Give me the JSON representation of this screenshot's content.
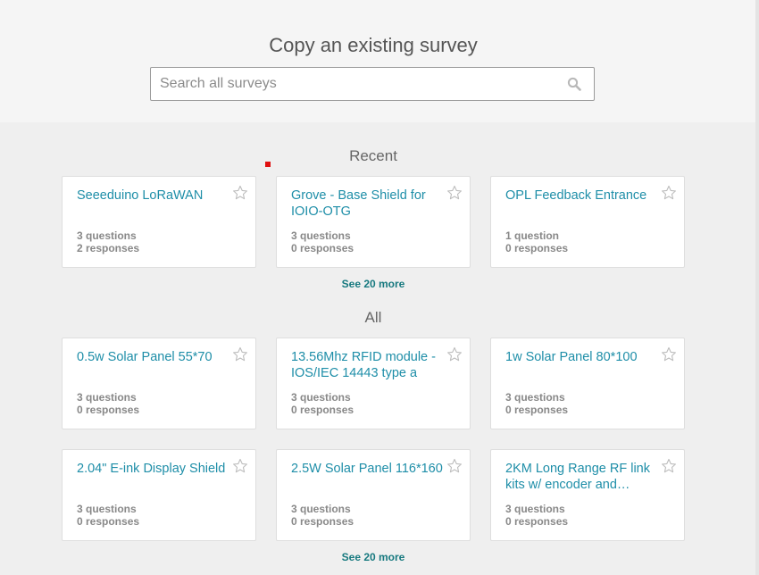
{
  "header": {
    "title": "Copy an existing survey",
    "search_placeholder": "Search all surveys",
    "search_icon": "search-icon"
  },
  "recent": {
    "heading": "Recent",
    "see_more": "See 20 more",
    "cards": [
      {
        "title": "Seeeduino LoRaWAN",
        "questions": "3 questions",
        "responses": "2 responses"
      },
      {
        "title": "Grove - Base Shield for IOIO-OTG",
        "questions": "3 questions",
        "responses": "0 responses"
      },
      {
        "title": "OPL Feedback Entrance",
        "questions": "1 question",
        "responses": "0 responses"
      }
    ]
  },
  "all": {
    "heading": "All",
    "see_more": "See 20 more",
    "cards": [
      {
        "title": "0.5w Solar Panel 55*70",
        "questions": "3 questions",
        "responses": "0 responses"
      },
      {
        "title": "13.56Mhz RFID module - IOS/IEC 14443 type a",
        "questions": "3 questions",
        "responses": "0 responses"
      },
      {
        "title": "1w Solar Panel 80*100",
        "questions": "3 questions",
        "responses": "0 responses"
      },
      {
        "title": "2.04\" E-ink Display Shield",
        "questions": "3 questions",
        "responses": "0 responses"
      },
      {
        "title": "2.5W Solar Panel 116*160",
        "questions": "3 questions",
        "responses": "0 responses"
      },
      {
        "title": "2KM Long Range RF link kits w/ encoder and…",
        "questions": "3 questions",
        "responses": "0 responses"
      }
    ]
  },
  "colors": {
    "title_link": "#1e8ea8",
    "see_more": "#17797f",
    "marker": "#e01010"
  }
}
